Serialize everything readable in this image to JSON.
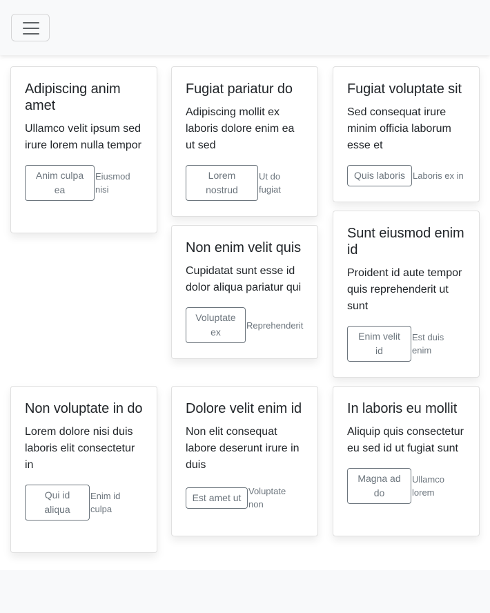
{
  "navbar": {
    "toggler_icon": "hamburger-icon"
  },
  "cards": [
    {
      "title": "Adipiscing anim amet",
      "text": "Ullamco velit ipsum sed irure lorem nulla tempor",
      "button": "Anim culpa ea",
      "note": "Eiusmod nisi"
    },
    {
      "title": "Fugiat pariatur do",
      "text": "Adipiscing mollit ex laboris dolore enim ea ut sed",
      "button": "Lorem nostrud",
      "note": "Ut do fugiat"
    },
    {
      "title": "Fugiat voluptate sit",
      "text": "Sed consequat irure minim officia laborum esse et",
      "button": "Quis laboris",
      "note": "Laboris ex in"
    },
    {
      "title": "Non enim velit quis",
      "text": "Cupidatat sunt esse id dolor aliqua pariatur qui",
      "button": "Voluptate ex",
      "note": "Reprehenderit"
    },
    {
      "title": "Sunt eiusmod enim id",
      "text": "Proident id aute tempor quis reprehenderit ut sunt",
      "button": "Enim velit id",
      "note": "Est duis enim"
    },
    {
      "title": "Non voluptate in do",
      "text": "Lorem dolore nisi duis laboris elit consectetur in",
      "button": "Qui id aliqua",
      "note": "Enim id culpa"
    },
    {
      "title": "Dolore velit enim id",
      "text": "Non elit consequat labore deserunt irure in duis",
      "button": "Est amet ut",
      "note": "Voluptate non"
    },
    {
      "title": "In laboris eu mollit",
      "text": "Aliquip quis consectetur eu sed id ut fugiat sunt",
      "button": "Magna ad do",
      "note": "Ullamco lorem"
    }
  ]
}
